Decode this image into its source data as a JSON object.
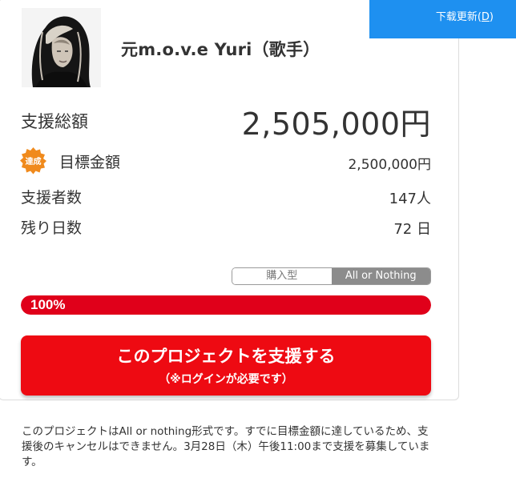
{
  "project": {
    "title": "元m.o.v.e Yuri（歌手）"
  },
  "stats": {
    "total_label": "支援総額",
    "total_value": "2,505,000円",
    "goal_badge": "達成",
    "goal_label": "目標金額",
    "goal_value": "2,500,000円",
    "supporters_label": "支援者数",
    "supporters_value": "147人",
    "days_left_label": "残り日数",
    "days_left_value": "72 日"
  },
  "funding_type": {
    "options": [
      "購入型",
      "All or Nothing"
    ],
    "selected": "All or Nothing"
  },
  "progress": {
    "percent_text": "100%",
    "fraction": 1.0
  },
  "support_button": {
    "label": "このプロジェクトを支援する",
    "sub_label": "（※ログインが必要です）"
  },
  "note": "このプロジェクトはAll or nothing形式です。すでに目標金額に達しているため、支援後のキャンセルはできません。3月28日（木）午後11:00まで支援を募集しています。",
  "download": {
    "label": "下载更新",
    "shortcut_open": "(",
    "shortcut_key": "D",
    "shortcut_close": ")"
  },
  "colors": {
    "accent_red": "#ee0a12",
    "progress_red": "#e0001a",
    "badge_orange": "#f08a1c",
    "download_blue": "#1e90f0"
  }
}
